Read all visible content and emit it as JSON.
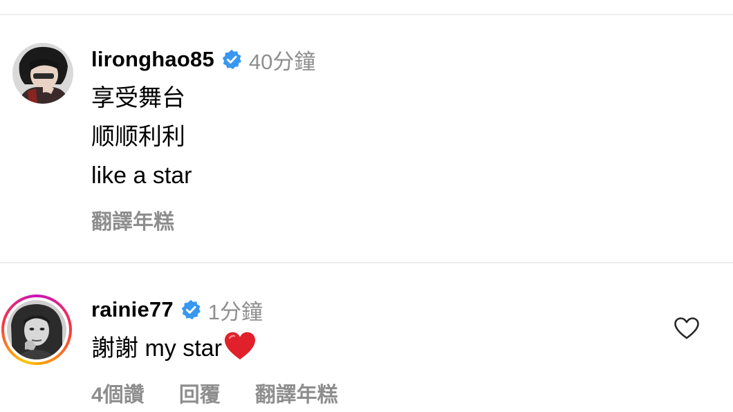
{
  "comments": [
    {
      "username": "lironghao85",
      "verified": true,
      "time": "40分鐘",
      "lines": [
        "享受舞台",
        "顺顺利利",
        "like a star"
      ],
      "actions": {
        "translate": "翻譯年糕"
      }
    },
    {
      "username": "rainie77",
      "verified": true,
      "time": "1分鐘",
      "text": "謝謝 my star",
      "emoji": "heart-emoji",
      "actions": {
        "likes": "4個讚",
        "reply": "回覆",
        "translate": "翻譯年糕"
      },
      "like_icon": "heart-outline-icon"
    }
  ],
  "colors": {
    "verified_badge": "#3897f0",
    "secondary_text": "#8e8e8e",
    "divider": "#ececec",
    "heart_emoji": "#e0202a"
  }
}
